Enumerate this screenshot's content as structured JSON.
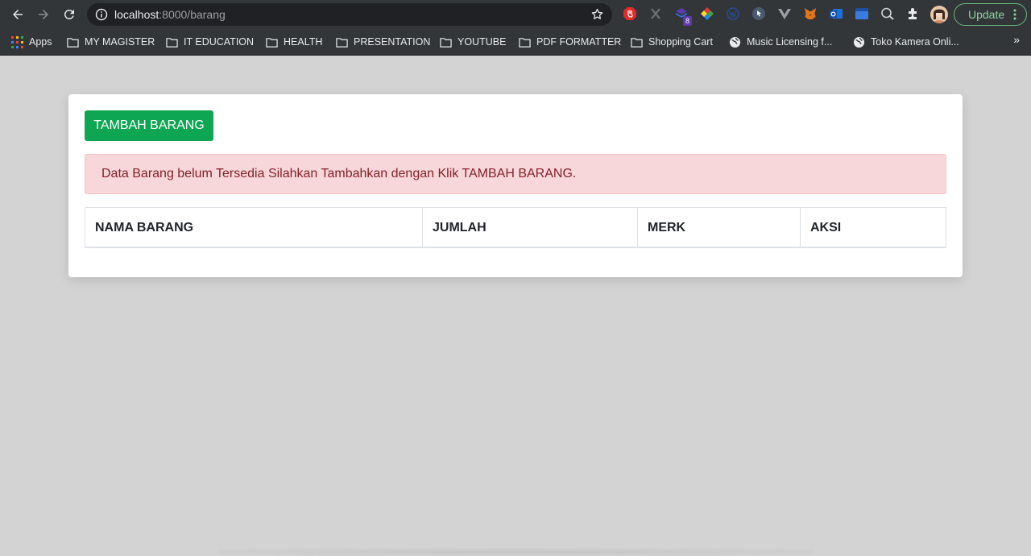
{
  "browser": {
    "url_host": "localhost",
    "url_path": ":8000/barang",
    "update_label": "Update",
    "extension_badge": "8",
    "bookmarks": [
      {
        "label": "Apps",
        "icon": "apps-grid-icon"
      },
      {
        "label": "MY MAGISTER",
        "icon": "folder-icon"
      },
      {
        "label": "IT EDUCATION",
        "icon": "folder-icon"
      },
      {
        "label": "HEALTH",
        "icon": "folder-icon"
      },
      {
        "label": "PRESENTATION",
        "icon": "folder-icon"
      },
      {
        "label": "YOUTUBE",
        "icon": "folder-icon"
      },
      {
        "label": "PDF FORMATTER",
        "icon": "folder-icon"
      },
      {
        "label": "Shopping Cart",
        "icon": "folder-icon"
      },
      {
        "label": "Music Licensing f...",
        "icon": "globe-icon"
      },
      {
        "label": "Toko Kamera Onli...",
        "icon": "globe-icon"
      }
    ],
    "more_bookmarks": "»"
  },
  "page": {
    "add_button_label": "TAMBAH BARANG",
    "alert_text": "Data Barang belum Tersedia Silahkan Tambahkan dengan Klik TAMBAH BARANG.",
    "table_headers": [
      "NAMA BARANG",
      "JUMLAH",
      "MERK",
      "AKSI"
    ]
  },
  "colors": {
    "primary_button": "#0ea653",
    "alert_background": "#f8d7da",
    "alert_text": "#842029",
    "page_background": "#d3d3d3"
  }
}
